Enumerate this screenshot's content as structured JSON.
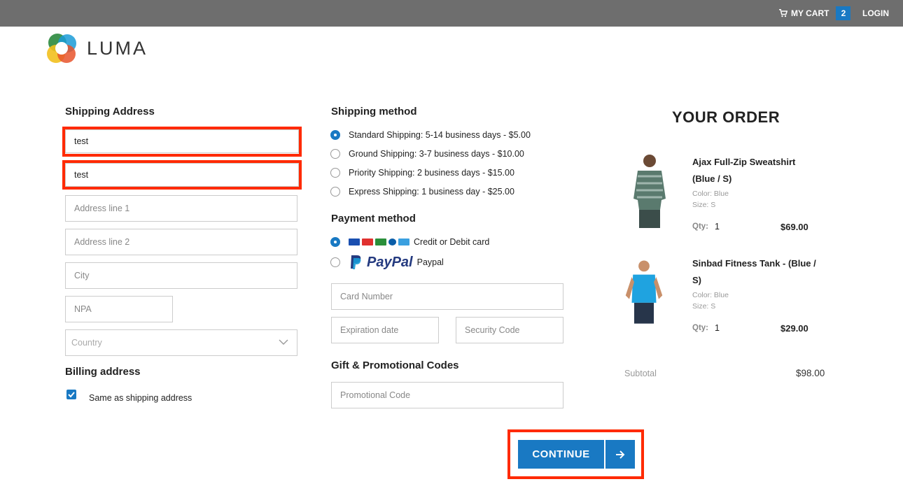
{
  "header": {
    "cart_label": "MY CART",
    "cart_count": "2",
    "login_label": "LOGIN",
    "logo_text": "LUMA"
  },
  "shipping_address": {
    "title": "Shipping Address",
    "first_name_value": "test",
    "last_name_value": "test",
    "address1_placeholder": "Address line 1",
    "address2_placeholder": "Address line 2",
    "city_placeholder": "City",
    "npa_placeholder": "NPA",
    "country_placeholder": "Country"
  },
  "billing": {
    "title": "Billing address",
    "same_label": "Same as shipping address",
    "same_checked": true
  },
  "shipping_method": {
    "title": "Shipping method",
    "options": [
      {
        "label": "Standard Shipping: 5-14 business days - $5.00",
        "selected": true
      },
      {
        "label": "Ground Shipping: 3-7 business days - $10.00",
        "selected": false
      },
      {
        "label": "Priority Shipping: 2 business days - $15.00",
        "selected": false
      },
      {
        "label": "Express Shipping: 1 business day - $25.00",
        "selected": false
      }
    ]
  },
  "payment_method": {
    "title": "Payment method",
    "card_label": "Credit or Debit card",
    "paypal_logo_text": "PayPal",
    "paypal_label": "Paypal",
    "card_number_placeholder": "Card Number",
    "expiration_placeholder": "Expiration date",
    "security_placeholder": "Security Code",
    "card_colors": [
      "#1a4fb0",
      "#e0312f",
      "#2a8f3a",
      "#0b5ea8",
      "#3aa0e0"
    ]
  },
  "promo": {
    "title": "Gift & Promotional Codes",
    "placeholder": "Promotional Code"
  },
  "order": {
    "title": "YOUR ORDER",
    "items": [
      {
        "name": "Ajax Full-Zip Sweatshirt (Blue / S)",
        "color": "Color: Blue",
        "size": "Size: S",
        "qty_label": "Qty:",
        "qty": "1",
        "price": "$69.00"
      },
      {
        "name": "Sinbad Fitness Tank - (Blue / S)",
        "color": "Color: Blue",
        "size": "Size: S",
        "qty_label": "Qty:",
        "qty": "1",
        "price": "$29.00"
      }
    ],
    "subtotal_label": "Subtotal",
    "subtotal_value": "$98.00"
  },
  "actions": {
    "continue_label": "CONTINUE"
  },
  "colors": {
    "accent": "#1979c3",
    "topbar": "#6e6e6e",
    "highlight": "#ff2a00"
  }
}
